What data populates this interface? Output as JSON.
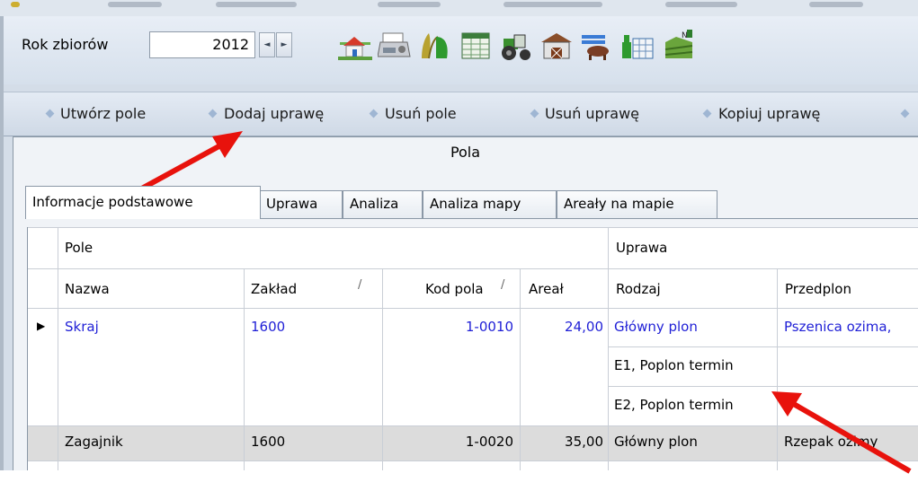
{
  "toolbar": {
    "rok_label": "Rok zbiorów",
    "year_value": "2012",
    "spin_prev": "◄",
    "spin_next": "►",
    "icons": [
      "farm-house-icon",
      "printer-fax-icon",
      "grain-fertilizer-icon",
      "spreadsheet-icon",
      "tractor-icon",
      "barn-icon",
      "livestock-icon",
      "warehouse-icon",
      "field-fertilizer-icon"
    ]
  },
  "actions": [
    "Utwórz pole",
    "Dodaj uprawę",
    "Usuń pole",
    "Usuń uprawę",
    "Kopiuj uprawę"
  ],
  "panel": {
    "title": "Pola"
  },
  "tabs": [
    "Informacje podstawowe",
    "Uprawa",
    "Analiza",
    "Analiza mapy",
    "Areały na mapie"
  ],
  "grid": {
    "group_headers": [
      "Pole",
      "Uprawa"
    ],
    "columns": [
      "Nazwa",
      "Zakład",
      "Kod pola",
      "Areał",
      "Rodzaj",
      "Przedplon"
    ],
    "rows": [
      {
        "nazwa": "Skraj",
        "zaklad": "1600",
        "kod": "1-0010",
        "areal": "24,00",
        "rodzaj": "Główny plon",
        "przedplon": "Pszenica ozima,"
      },
      {
        "nazwa": "",
        "zaklad": "",
        "kod": "",
        "areal": "",
        "rodzaj": "E1, Poplon termin",
        "przedplon": ""
      },
      {
        "nazwa": "",
        "zaklad": "",
        "kod": "",
        "areal": "",
        "rodzaj": "E2, Poplon termin",
        "przedplon": ""
      },
      {
        "nazwa": "Zagajnik",
        "zaklad": "1600",
        "kod": "1-0020",
        "areal": "35,00",
        "rodzaj": "Główny plon",
        "przedplon": "Rzepak ozimy"
      }
    ]
  },
  "colors": {
    "link_blue": "#1f1fd6",
    "arrow_red": "#e8120c"
  }
}
